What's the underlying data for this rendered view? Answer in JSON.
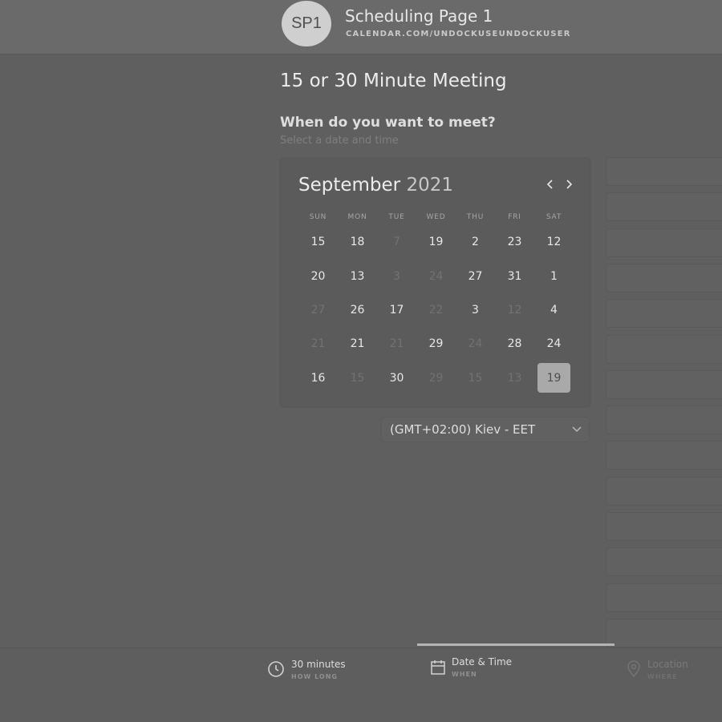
{
  "header": {
    "avatar_initials": "SP1",
    "page_name": "Scheduling Page 1",
    "page_url": "CALENDAR.COM/UNDOCKUSEUNDOCKUSER"
  },
  "meeting": {
    "title": "15 or 30 Minute Meeting",
    "question": "When do you want to meet?",
    "hint": "Select a date and time"
  },
  "calendar": {
    "month": "September",
    "year": "2021",
    "prev_icon": "chevron-left-icon",
    "next_icon": "chevron-right-icon",
    "weekdays": [
      "SUN",
      "MON",
      "TUE",
      "WED",
      "THU",
      "FRI",
      "SAT"
    ],
    "weeks": [
      [
        {
          "d": "15",
          "available": true
        },
        {
          "d": "18",
          "available": true
        },
        {
          "d": "7",
          "available": false
        },
        {
          "d": "19",
          "available": true
        },
        {
          "d": "2",
          "available": true
        },
        {
          "d": "23",
          "available": true
        },
        {
          "d": "12",
          "available": true
        }
      ],
      [
        {
          "d": "20",
          "available": true
        },
        {
          "d": "13",
          "available": true
        },
        {
          "d": "3",
          "available": false
        },
        {
          "d": "24",
          "available": false
        },
        {
          "d": "27",
          "available": true
        },
        {
          "d": "31",
          "available": true
        },
        {
          "d": "1",
          "available": true
        }
      ],
      [
        {
          "d": "27",
          "available": false
        },
        {
          "d": "26",
          "available": true
        },
        {
          "d": "17",
          "available": true
        },
        {
          "d": "22",
          "available": false
        },
        {
          "d": "3",
          "available": true
        },
        {
          "d": "12",
          "available": false
        },
        {
          "d": "4",
          "available": true
        }
      ],
      [
        {
          "d": "21",
          "available": false
        },
        {
          "d": "21",
          "available": true
        },
        {
          "d": "21",
          "available": false
        },
        {
          "d": "29",
          "available": true
        },
        {
          "d": "24",
          "available": false
        },
        {
          "d": "28",
          "available": true
        },
        {
          "d": "24",
          "available": true
        }
      ],
      [
        {
          "d": "16",
          "available": true
        },
        {
          "d": "15",
          "available": false
        },
        {
          "d": "30",
          "available": true
        },
        {
          "d": "29",
          "available": false
        },
        {
          "d": "15",
          "available": false
        },
        {
          "d": "13",
          "available": false
        },
        {
          "d": "19",
          "available": true,
          "selected": true
        }
      ]
    ]
  },
  "timezone": {
    "value": "(GMT+02:00) Kiev - EET",
    "icon": "chevron-down-icon"
  },
  "time_slots_count": 14,
  "footer": {
    "progress_step": 2,
    "steps": [
      {
        "label": "30 minutes",
        "sub": "HOW LONG",
        "icon": "clock-icon",
        "state": "done"
      },
      {
        "label": "Date & Time",
        "sub": "WHEN",
        "icon": "calendar-icon",
        "state": "active"
      },
      {
        "label": "Location",
        "sub": "WHERE",
        "icon": "location-pin-icon",
        "state": "disabled"
      }
    ]
  },
  "colors": {
    "background": "#5f5f5f",
    "selected_day": "#a9a9a9",
    "muted_text": "#727272"
  }
}
